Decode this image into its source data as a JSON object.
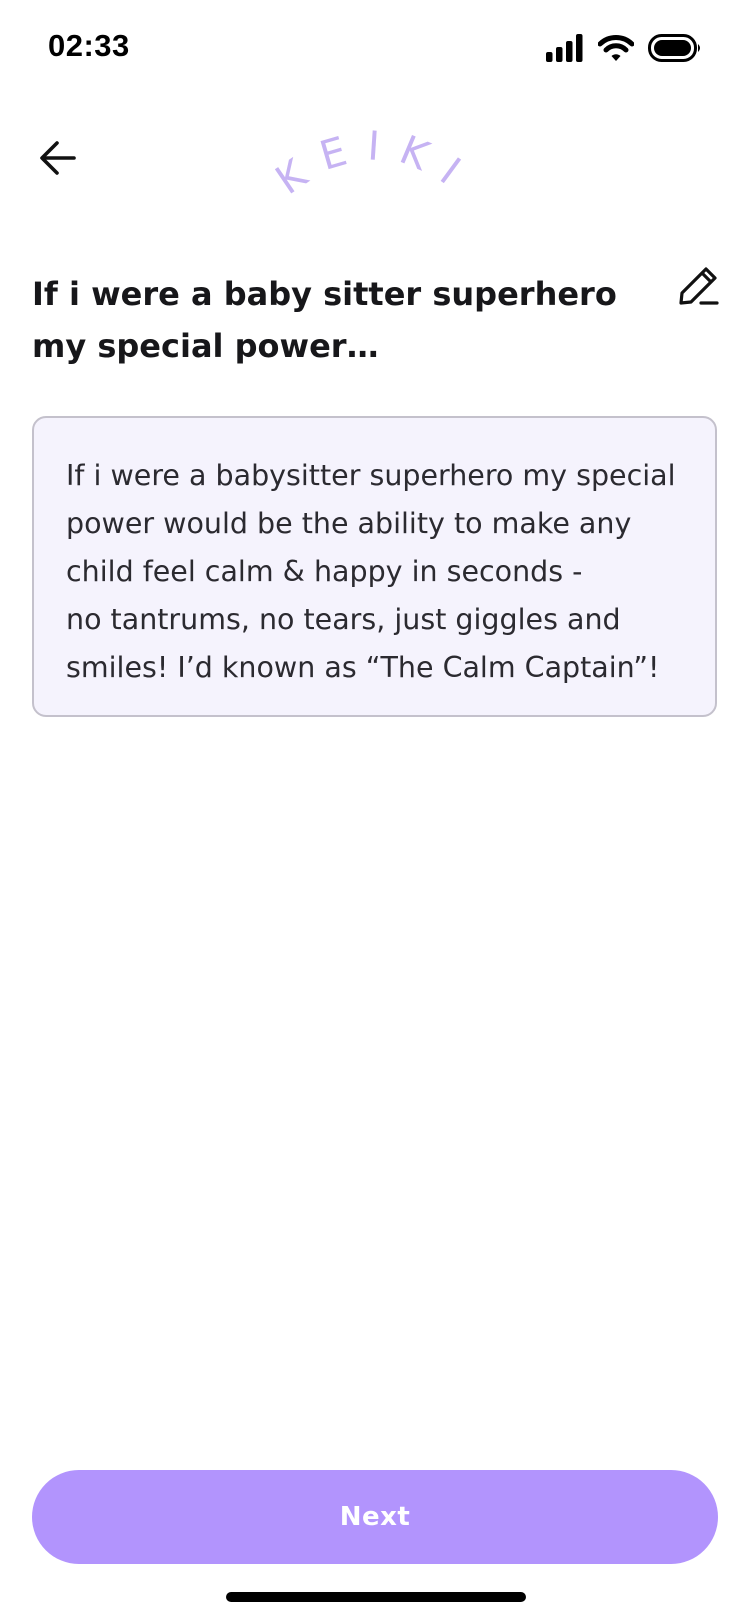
{
  "status_bar": {
    "time": "02:33",
    "icons": [
      "cellular-signal-icon",
      "wifi-icon",
      "battery-icon"
    ]
  },
  "header": {
    "back_icon": "arrow-left-icon",
    "logo_text": "KEIKI",
    "logo_color": "#c6b3f3"
  },
  "prompt": {
    "title": "If i were a baby sitter superhero my special power…",
    "edit_icon": "pencil-icon"
  },
  "answer": {
    "text": "If i were a babysitter superhero my special power would be the ability to make any child feel calm & happy in seconds -\nno tantrums, no tears, just giggles and smiles! I’d known as “The Calm Captain”!"
  },
  "footer": {
    "next_label": "Next",
    "accent_color": "#b294fd"
  }
}
